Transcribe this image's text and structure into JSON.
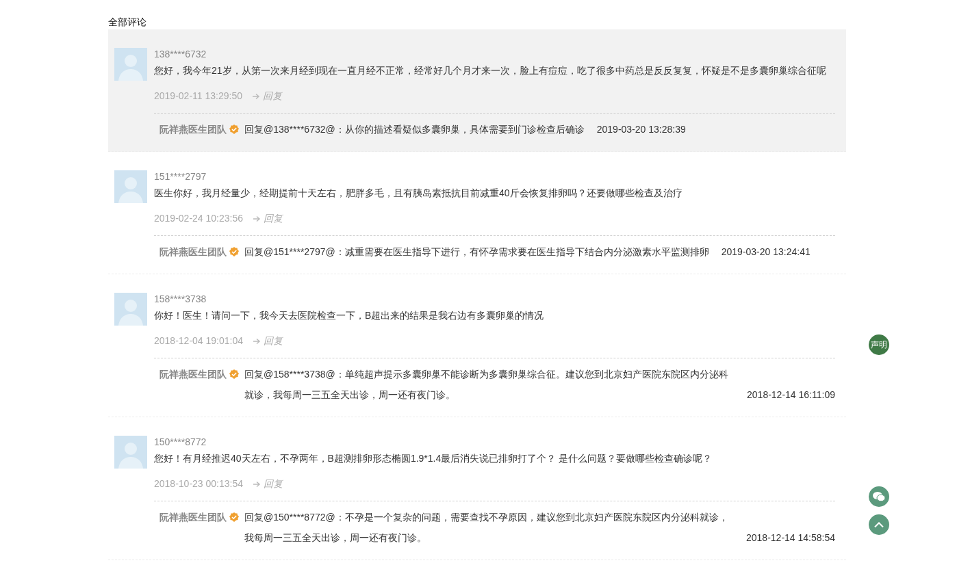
{
  "section_title": "全部评论",
  "comments": [
    {
      "user": "138****6732",
      "highlighted": true,
      "text": "您好，我今年21岁，从第一次来月经到现在一直月经不正常，经常好几个月才来一次，脸上有痘痘，吃了很多中药总是反反复复，怀疑是不是多囊卵巢综合征呢",
      "time": "2019-02-11 13:29:50",
      "reply_label": "回复",
      "reply": {
        "author": "阮祥燕医生团队",
        "text": "回复@138****6732@：从你的描述看疑似多囊卵巢，具体需要到门诊检查后确诊",
        "time": "2019-03-20 13:28:39"
      }
    },
    {
      "user": "151****2797",
      "highlighted": false,
      "text": "医生你好，我月经量少，经期提前十天左右，肥胖多毛，且有胰岛素抵抗目前减重40斤会恢复排卵吗？还要做哪些检查及治疗",
      "time": "2019-02-24 10:23:56",
      "reply_label": "回复",
      "reply": {
        "author": "阮祥燕医生团队",
        "text": "回复@151****2797@：减重需要在医生指导下进行，有怀孕需求要在医生指导下结合内分泌激素水平监测排卵",
        "time": "2019-03-20 13:24:41"
      }
    },
    {
      "user": "158****3738",
      "highlighted": false,
      "text": "你好！医生！请问一下，我今天去医院检查一下，B超出来的结果是我右边有多囊卵巢的情况",
      "time": "2018-12-04 19:01:04",
      "reply_label": "回复",
      "reply": {
        "author": "阮祥燕医生团队",
        "text": "回复@158****3738@：单纯超声提示多囊卵巢不能诊断为多囊卵巢综合征。建议您到北京妇产医院东院区内分泌科就诊，我每周一三五全天出诊，周一还有夜门诊。",
        "time": "2018-12-14 16:11:09"
      }
    },
    {
      "user": "150****8772",
      "highlighted": false,
      "text": "您好！有月经推迟40天左右，不孕两年，B超测排卵形态椭圆1.9*1.4最后消失说已排卵打了个？ 是什么问题？要做哪些检查确诊呢？",
      "time": "2018-10-23 00:13:54",
      "reply_label": "回复",
      "reply": {
        "author": "阮祥燕医生团队",
        "text": "回复@150****8772@：不孕是一个复杂的问题，需要查找不孕原因，建议您到北京妇产医院东院区内分泌科就诊，我每周一三五全天出诊，周一还有夜门诊。",
        "time": "2018-12-14 14:58:54"
      }
    }
  ],
  "side_buttons": {
    "statement_label": "声明"
  }
}
